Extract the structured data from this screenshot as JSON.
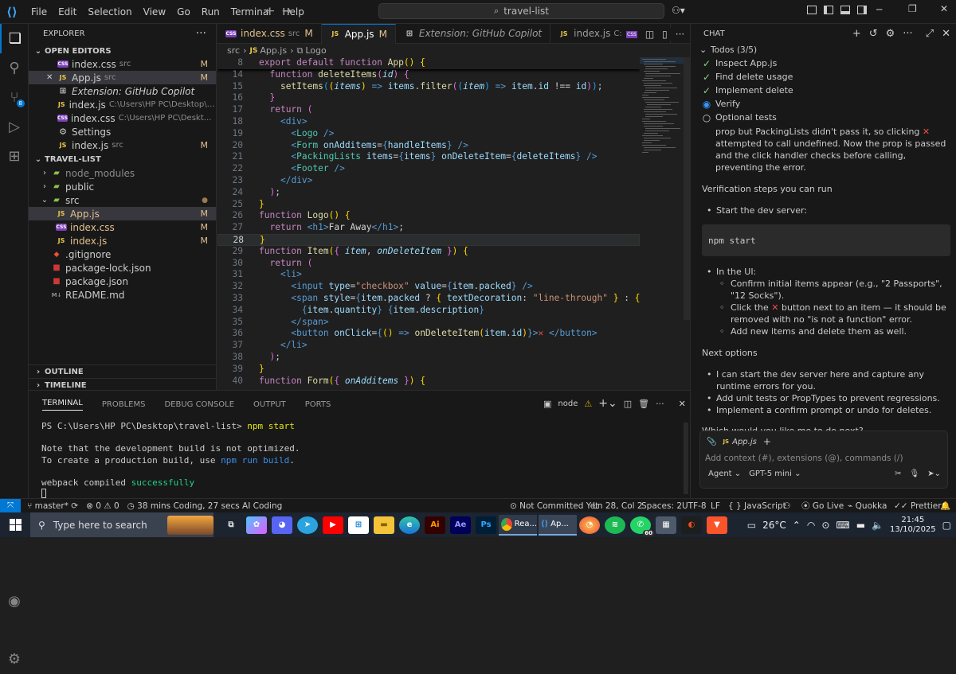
{
  "menu": [
    "File",
    "Edit",
    "Selection",
    "View",
    "Go",
    "Run",
    "Terminal",
    "Help"
  ],
  "search": "travel-list",
  "explorer": {
    "title": "EXPLORER",
    "open_editors": "OPEN EDITORS",
    "open_files": [
      {
        "name": "index.css",
        "path": "src",
        "type": "css",
        "badge": "M"
      },
      {
        "name": "App.js",
        "path": "src",
        "type": "js",
        "badge": "M",
        "close": "✕"
      },
      {
        "name": "Extension: GitHub Copilot",
        "path": "",
        "type": "ext",
        "badge": ""
      },
      {
        "name": "index.js",
        "path": "C:\\Users\\HP PC\\Desktop\\ultimate-...",
        "type": "js",
        "badge": ""
      },
      {
        "name": "index.css",
        "path": "C:\\Users\\HP PC\\Desktop\\ultimat...",
        "type": "css",
        "badge": ""
      },
      {
        "name": "Settings",
        "path": "",
        "type": "gear",
        "badge": ""
      },
      {
        "name": "index.js",
        "path": "src",
        "type": "js",
        "badge": "M"
      }
    ],
    "project": "TRAVEL-LIST",
    "tree": [
      {
        "name": "node_modules",
        "type": "folder",
        "open": false,
        "indent": 1,
        "dim": true
      },
      {
        "name": "public",
        "type": "folder",
        "open": false,
        "indent": 1
      },
      {
        "name": "src",
        "type": "folder",
        "open": true,
        "indent": 1,
        "dot": "●"
      },
      {
        "name": "App.js",
        "type": "js",
        "indent": 2,
        "badge": "M",
        "sel": true
      },
      {
        "name": "index.css",
        "type": "css",
        "indent": 2,
        "badge": "M"
      },
      {
        "name": "index.js",
        "type": "js",
        "indent": 2,
        "badge": "M"
      },
      {
        "name": ".gitignore",
        "type": "git",
        "indent": 1
      },
      {
        "name": "package-lock.json",
        "type": "npm",
        "indent": 1
      },
      {
        "name": "package.json",
        "type": "npm",
        "indent": 1
      },
      {
        "name": "README.md",
        "type": "md",
        "indent": 1
      }
    ],
    "outline": "OUTLINE",
    "timeline": "TIMELINE"
  },
  "tabs": [
    {
      "label": "index.css",
      "sub": "src",
      "badge": "M",
      "type": "css"
    },
    {
      "label": "App.js",
      "sub": "",
      "badge": "M",
      "type": "js",
      "active": true
    },
    {
      "label": "Extension: GitHub Copilot",
      "sub": "",
      "badge": "",
      "type": "ext"
    },
    {
      "label": "index.js",
      "sub": "C:\\...\\final\\...",
      "badge": "",
      "type": "js"
    }
  ],
  "breadcrumb": [
    "src",
    "App.js",
    "Logo"
  ],
  "code": [
    {
      "n": "8",
      "h": "<span class=kw>export default function</span> <span class=fn>App</span><span class=br>()</span> <span class=br>{</span>"
    },
    {
      "n": "14",
      "h": "  <span class=kw>function</span> <span class=fn>deleteItems</span><span class=br2>(</span><span class=it>id</span><span class=br2>)</span> <span class=br2>{</span>"
    },
    {
      "n": "15",
      "h": "    <span class=fn>setItems</span><span class=br3>(</span><span class=br>(</span><span class=it>items</span><span class=br>)</span> <span class=tg>=&gt;</span> <span class=vr>items</span>.<span class=fn>filter</span><span class=br2>(</span><span class=br3>(</span><span class=it>item</span><span class=br3>)</span> <span class=tg>=&gt;</span> <span class=vr>item</span>.<span class=vr>id</span> <span class=pl>!==</span> <span class=vr>id</span><span class=br2>)</span><span class=br3>)</span>;"
    },
    {
      "n": "16",
      "h": "  <span class=br2>}</span>"
    },
    {
      "n": "17",
      "h": "  <span class=kw>return</span> <span class=br2>(</span>"
    },
    {
      "n": "18",
      "h": "    <span class=tg>&lt;</span><span class=tg>div</span><span class=tg>&gt;</span>"
    },
    {
      "n": "19",
      "h": "      <span class=tg>&lt;</span><span class=cm>Logo</span> <span class=tg>/&gt;</span>"
    },
    {
      "n": "20",
      "h": "      <span class=tg>&lt;</span><span class=cm>Form</span> <span class=vr>onAdditems</span>=<span class=tg>{</span><span class=vr>handleItems</span><span class=tg>}</span> <span class=tg>/&gt;</span>"
    },
    {
      "n": "21",
      "h": "      <span class=tg>&lt;</span><span class=cm>PackingLists</span> <span class=vr>items</span>=<span class=tg>{</span><span class=vr>items</span><span class=tg>}</span> <span class=vr>onDeleteItem</span>=<span class=tg>{</span><span class=vr>deleteItems</span><span class=tg>}</span> <span class=tg>/&gt;</span>"
    },
    {
      "n": "22",
      "h": "      <span class=tg>&lt;</span><span class=cm>Footer</span> <span class=tg>/&gt;</span>"
    },
    {
      "n": "23",
      "h": "    <span class=tg>&lt;/</span><span class=tg>div</span><span class=tg>&gt;</span>"
    },
    {
      "n": "24",
      "h": "  <span class=br2>)</span>;"
    },
    {
      "n": "25",
      "h": "<span class=br>}</span>"
    },
    {
      "n": "26",
      "h": "<span class=kw>function</span> <span class=fn>Logo</span><span class=br>()</span> <span class=br>{</span>"
    },
    {
      "n": "27",
      "h": "  <span class=kw>return</span> <span class=tg>&lt;h1&gt;</span><span class=pl>Far Away</span><span class=tg>&lt;/h1&gt;</span>;"
    },
    {
      "n": "28",
      "h": "<span class=br>}</span>",
      "cur": true
    },
    {
      "n": "29",
      "h": "<span class=kw>function</span> <span class=fn>Item</span><span class=br>(</span><span class=br2>{</span> <span class=it>item</span>, <span class=it>onDeleteItem</span> <span class=br2>}</span><span class=br>)</span> <span class=br>{</span>"
    },
    {
      "n": "30",
      "h": "  <span class=kw>return</span> <span class=br2>(</span>"
    },
    {
      "n": "31",
      "h": "    <span class=tg>&lt;li&gt;</span>"
    },
    {
      "n": "32",
      "h": "      <span class=tg>&lt;input</span> <span class=vr>type</span>=<span class=str>\"checkbox\"</span> <span class=vr>value</span>=<span class=tg>{</span><span class=vr>item</span>.<span class=vr>packed</span><span class=tg>}</span> <span class=tg>/&gt;</span>"
    },
    {
      "n": "33",
      "h": "      <span class=tg>&lt;span</span> <span class=vr>style</span>=<span class=tg>{</span><span class=vr>item</span>.<span class=vr>packed</span> <span class=pl>?</span> <span class=br>{</span> <span class=vr>textDecoration</span>: <span class=str>\"line-through\"</span> <span class=br>}</span> : <span class=br>{}</span><span class=tg>}</span><span class=tg>&gt;</span>"
    },
    {
      "n": "34",
      "h": "        <span class=tg>{</span><span class=vr>item</span>.<span class=vr>quantity</span><span class=tg>}</span> <span class=tg>{</span><span class=vr>item</span>.<span class=vr>description</span><span class=tg>}</span>"
    },
    {
      "n": "35",
      "h": "      <span class=tg>&lt;/span&gt;</span>"
    },
    {
      "n": "36",
      "h": "      <span class=tg>&lt;button</span> <span class=vr>onClick</span>=<span class=tg>{</span><span class=br>()</span> <span class=tg>=&gt;</span> <span class=fn>onDeleteItem</span><span class=br>(</span><span class=vr>item</span>.<span class=vr>id</span><span class=br>)</span><span class=tg>}</span><span class=tg>&gt;</span><span class=x>✕</span> <span class=tg>&lt;/button&gt;</span>"
    },
    {
      "n": "37",
      "h": "    <span class=tg>&lt;/li&gt;</span>"
    },
    {
      "n": "38",
      "h": "  <span class=br2>)</span>;"
    },
    {
      "n": "39",
      "h": "<span class=br>}</span>"
    },
    {
      "n": "40",
      "h": "<span class=kw>function</span> <span class=fn>Form</span><span class=br>(</span><span class=br2>{</span> <span class=it>onAdditems</span> <span class=br2>}</span><span class=br>)</span> <span class=br>{</span>"
    }
  ],
  "panel": {
    "tabs": [
      "TERMINAL",
      "PROBLEMS",
      "DEBUG CONSOLE",
      "OUTPUT",
      "PORTS"
    ],
    "node": "node",
    "prompt": "PS C:\\Users\\HP PC\\Desktop\\travel-list>",
    "cmd": "npm start",
    "line1": "Note that the development build is not optimized.",
    "line2a": "To create a production build, use ",
    "line2b": "npm run build",
    "line3a": "webpack compiled ",
    "line3b": "successfully"
  },
  "chat": {
    "title": "CHAT",
    "todos_label": "Todos (3/5)",
    "todos": [
      {
        "t": "Inspect App.js",
        "s": "done"
      },
      {
        "t": "Find delete usage",
        "s": "done"
      },
      {
        "t": "Implement delete",
        "s": "done"
      },
      {
        "t": "Verify",
        "s": "active"
      },
      {
        "t": "Optional tests",
        "s": "todo"
      }
    ],
    "para1a": "prop but PackingLists didn't pass it, so clicking ",
    "para1b": " attempted to call undefined. Now the prop is passed and the click handler checks before calling, preventing the error.",
    "verify_title": "Verification steps you can run",
    "step1": "Start the dev server:",
    "npm": "npm start",
    "step2": "In the UI:",
    "sub1": "Confirm initial items appear (e.g., \"2 Passports\", \"12 Socks\").",
    "sub2a": "Click the ",
    "sub2b": " button next to an item — it should be removed with no \"is not a function\" error.",
    "sub3": "Add new items and delete them as well.",
    "next_title": "Next options",
    "opt1": "I can start the dev server here and capture any runtime errors for you.",
    "opt2": "Add unit tests or PropTypes to prevent regressions.",
    "opt3": "Implement a confirm prompt or undo for deletes.",
    "question": "Which would you like me to do next?",
    "attach": "App.js",
    "placeholder": "Add context (#), extensions (@), commands (/)",
    "mode": "Agent",
    "model": "GPT-5 mini"
  },
  "status": {
    "branch": "master*",
    "errors": "0",
    "warnings": "0",
    "timer": "38 mins Coding, 27 secs AI Coding",
    "commit": "Not Committed Yet",
    "pos": "Ln 28, Col 2",
    "spaces": "Spaces: 2",
    "enc": "UTF-8",
    "eol": "LF",
    "lang": "JavaScript",
    "golive": "Go Live",
    "quokka": "Quokka",
    "prettier": "Prettier"
  },
  "taskbar": {
    "search": "Type here to search",
    "temp": "26°C",
    "time": "21:45",
    "date": "13/10/2025",
    "chrome": "Rea...",
    "vscode": "Ap..."
  },
  "colors": {
    "accent": "#0078d4",
    "status_remote": "#0078d4"
  }
}
